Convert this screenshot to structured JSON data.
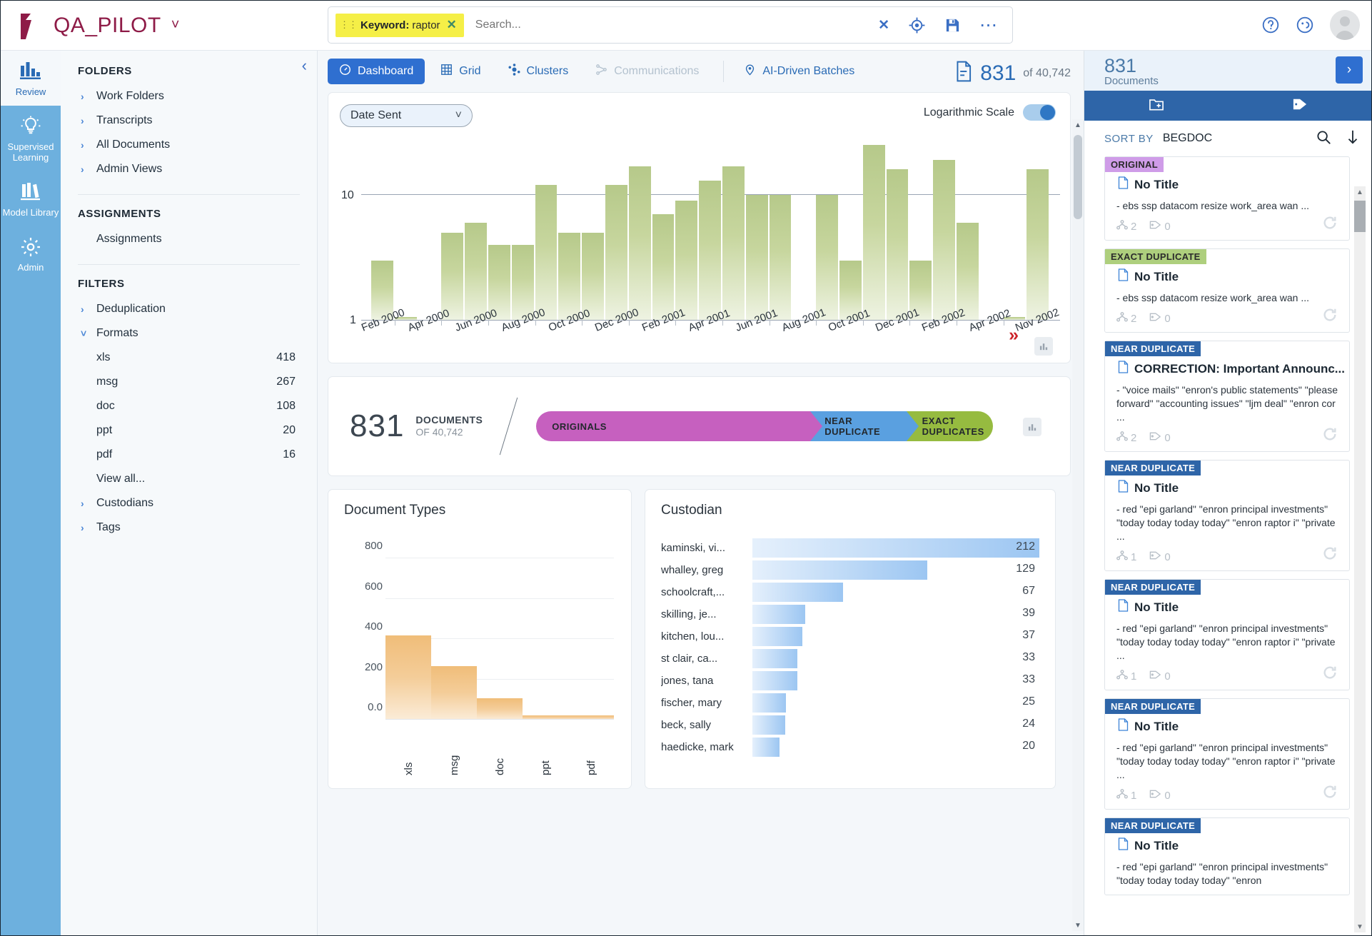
{
  "app": {
    "brand_name": "QA_PILOT",
    "brand_color": "#8e1b47"
  },
  "search": {
    "chip_label": "Keyword:",
    "chip_value": "raptor",
    "placeholder": "Search...",
    "clear_label": "x"
  },
  "rail": {
    "items": [
      {
        "label": "Review",
        "icon": "bar-chart-icon",
        "active": true
      },
      {
        "label": "Supervised Learning",
        "icon": "lightbulb-icon",
        "active": false
      },
      {
        "label": "Model Library",
        "icon": "books-icon",
        "active": false
      },
      {
        "label": "Admin",
        "icon": "gear-icon",
        "active": false
      }
    ]
  },
  "sidebar": {
    "folders_title": "FOLDERS",
    "folders": [
      {
        "label": "Work Folders",
        "state": "collapsed"
      },
      {
        "label": "Transcripts",
        "state": "collapsed"
      },
      {
        "label": "All Documents",
        "state": "collapsed"
      },
      {
        "label": "Admin Views",
        "state": "collapsed"
      }
    ],
    "assignments_title": "ASSIGNMENTS",
    "assignments_item": "Assignments",
    "filters_title": "FILTERS",
    "filters": [
      {
        "label": "Deduplication",
        "state": "collapsed"
      },
      {
        "label": "Formats",
        "state": "expanded"
      }
    ],
    "formats": [
      {
        "label": "xls",
        "count": "418"
      },
      {
        "label": "msg",
        "count": "267"
      },
      {
        "label": "doc",
        "count": "108"
      },
      {
        "label": "ppt",
        "count": "20"
      },
      {
        "label": "pdf",
        "count": "16"
      },
      {
        "label": "View all...",
        "count": ""
      }
    ],
    "filters_tail": [
      {
        "label": "Custodians",
        "state": "collapsed"
      },
      {
        "label": "Tags",
        "state": "collapsed"
      }
    ]
  },
  "main": {
    "tabs": [
      {
        "label": "Dashboard",
        "icon": "speedometer-icon",
        "active": true,
        "disabled": false
      },
      {
        "label": "Grid",
        "icon": "grid-icon",
        "active": false,
        "disabled": false
      },
      {
        "label": "Clusters",
        "icon": "clusters-icon",
        "active": false,
        "disabled": false
      },
      {
        "label": "Communications",
        "icon": "communications-icon",
        "active": false,
        "disabled": true
      },
      {
        "label": "AI-Driven Batches",
        "icon": "pin-bulb-icon",
        "active": false,
        "disabled": false
      }
    ],
    "doc_count": "831",
    "doc_total": "of 40,742"
  },
  "timeline": {
    "field_select": "Date Sent",
    "log_label": "Logarithmic Scale",
    "log_enabled": true
  },
  "dedupe": {
    "count": "831",
    "label_main": "DOCUMENTS",
    "label_sub": "OF 40,742",
    "segments": [
      {
        "label": "ORIGINALS",
        "color": "#c660bf",
        "width_pct": 60
      },
      {
        "label": "NEAR DUPLICATE",
        "color": "#5aa0e0",
        "width_pct": 21
      },
      {
        "label": "EXACT DUPLICATES",
        "color": "#96bb40",
        "width_pct": 19
      }
    ]
  },
  "right_panel": {
    "count": "831",
    "count_label": "Documents",
    "tabs": [
      {
        "icon": "folder-add-icon"
      },
      {
        "icon": "tag-icon"
      }
    ],
    "sort_by_label": "SORT BY",
    "sort_by_value": "BEGDOC",
    "documents": [
      {
        "badge": "ORIGINAL",
        "badge_type": "original",
        "title": "No Title",
        "snippet": "- ebs ssp datacom resize work_area wan ...",
        "family_count": "2",
        "tag_count": "0"
      },
      {
        "badge": "EXACT DUPLICATE",
        "badge_type": "exact",
        "title": "No Title",
        "snippet": "- ebs ssp datacom resize work_area wan ...",
        "family_count": "2",
        "tag_count": "0"
      },
      {
        "badge": "NEAR DUPLICATE",
        "badge_type": "near",
        "title": "CORRECTION: Important Announc...",
        "snippet": "- \"voice mails\" \"enron's public statements\" \"please forward\" \"accounting issues\" \"ljm deal\" \"enron cor ...",
        "family_count": "2",
        "tag_count": "0"
      },
      {
        "badge": "NEAR DUPLICATE",
        "badge_type": "near",
        "title": "No Title",
        "snippet": "- red \"epi garland\" \"enron principal investments\" \"today today today today\" \"enron raptor i\" \"private ...",
        "family_count": "1",
        "tag_count": "0"
      },
      {
        "badge": "NEAR DUPLICATE",
        "badge_type": "near",
        "title": "No Title",
        "snippet": "- red \"epi garland\" \"enron principal investments\" \"today today today today\" \"enron raptor i\" \"private ...",
        "family_count": "1",
        "tag_count": "0"
      },
      {
        "badge": "NEAR DUPLICATE",
        "badge_type": "near",
        "title": "No Title",
        "snippet": "- red \"epi garland\" \"enron principal investments\" \"today today today today\" \"enron raptor i\" \"private ...",
        "family_count": "1",
        "tag_count": "0"
      },
      {
        "badge": "NEAR DUPLICATE",
        "badge_type": "near",
        "title": "No Title",
        "snippet": "- red \"epi garland\" \"enron principal investments\" \"today today today today\" \"enron",
        "family_count": "",
        "tag_count": ""
      }
    ]
  },
  "chart_data": [
    {
      "type": "bar",
      "title": "Date Sent",
      "id": "timeline",
      "xlabel": "",
      "ylabel": "",
      "scale": "logarithmic",
      "grid": true,
      "ylim": [
        1,
        100
      ],
      "yticks": [
        "1",
        "10"
      ],
      "tick_labels": [
        "Feb 2000",
        "Apr 2000",
        "Jun 2000",
        "Aug 2000",
        "Oct 2000",
        "Dec 2000",
        "Feb 2001",
        "Apr 2001",
        "Jun 2001",
        "Aug 2001",
        "Oct 2001",
        "Dec 2001",
        "Feb 2002",
        "Apr 2002",
        "Nov 2002"
      ],
      "categories": [
        "Feb 2000",
        "Mar 2000",
        "Apr 2000",
        "May 2000",
        "Jun 2000",
        "Jul 2000",
        "Aug 2000",
        "Sep 2000",
        "Oct 2000",
        "Nov 2000",
        "Dec 2000",
        "Jan 2001",
        "Feb 2001",
        "Mar 2001",
        "Apr 2001",
        "May 2001",
        "Jun 2001",
        "Jul 2001",
        "Aug 2001",
        "Sep 2001",
        "Oct 2001",
        "Nov 2001",
        "Dec 2001",
        "Jan 2002",
        "Feb 2002",
        "Mar 2002",
        "Apr 2002",
        "Jun 2002",
        "Nov 2002"
      ],
      "values": [
        3,
        1,
        0,
        5,
        6,
        4,
        4,
        12,
        5,
        5,
        12,
        17,
        7,
        9,
        13,
        17,
        10,
        10,
        0,
        10,
        3,
        32,
        16,
        3,
        19,
        6,
        0,
        1,
        16
      ]
    },
    {
      "type": "bar",
      "id": "document-types",
      "title": "Document Types",
      "xlabel": "",
      "ylabel": "",
      "grid": true,
      "ylim": [
        0,
        900
      ],
      "yticks": [
        "800",
        "600",
        "400",
        "200",
        "0.0"
      ],
      "categories": [
        "xls",
        "msg",
        "doc",
        "ppt",
        "pdf"
      ],
      "values": [
        418,
        267,
        108,
        20,
        16
      ]
    },
    {
      "type": "bar",
      "id": "custodian",
      "orientation": "horizontal",
      "title": "Custodian",
      "xlabel": "",
      "ylabel": "",
      "grid": false,
      "categories": [
        "kaminski, vi...",
        "whalley, greg",
        "schoolcraft,...",
        "skilling, je...",
        "kitchen, lou...",
        "st clair, ca...",
        "jones, tana",
        "fischer, mary",
        "beck, sally",
        "haedicke, mark"
      ],
      "values": [
        212,
        129,
        67,
        39,
        37,
        33,
        33,
        25,
        24,
        20
      ]
    }
  ]
}
